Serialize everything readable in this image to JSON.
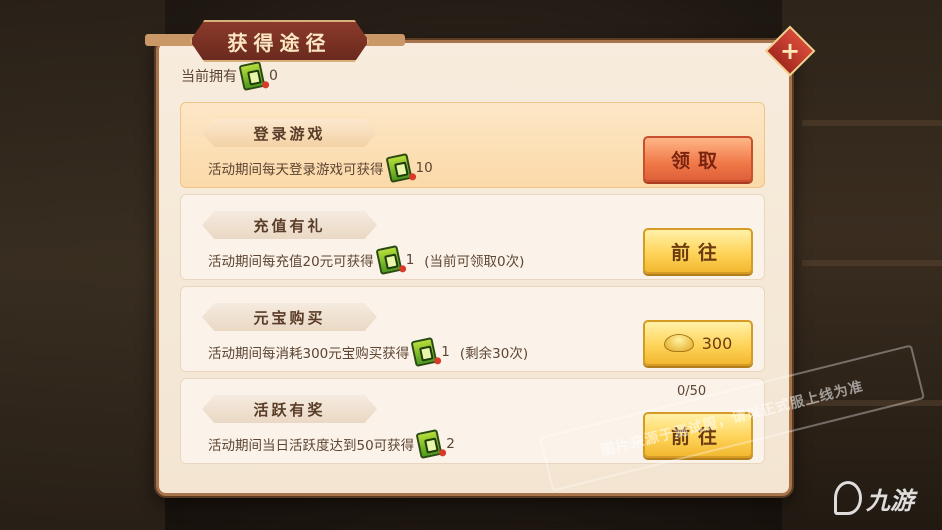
{
  "title": "获得途径",
  "owned": {
    "label": "当前拥有",
    "value": "0",
    "icon": "ticket-icon"
  },
  "close_label": "+",
  "rows": [
    {
      "tag": "登录游戏",
      "desc": "活动期间每天登录游戏可获得",
      "count": "10",
      "extra": "",
      "button": "领取",
      "button_style": "red"
    },
    {
      "tag": "充值有礼",
      "desc": "活动期间每充值20元可获得",
      "count": "1",
      "extra": "(当前可领取0次)",
      "button": "前往",
      "button_style": "yellow"
    },
    {
      "tag": "元宝购买",
      "desc": "活动期间每消耗300元宝购买获得",
      "count": "1",
      "extra": "(剩余30次)",
      "button": "300",
      "button_style": "yellow-ingot"
    },
    {
      "tag": "活跃有奖",
      "desc": "活动期间当日活跃度达到50可获得",
      "count": "2",
      "extra": "",
      "button": "前往",
      "button_style": "yellow",
      "progress": "0/50"
    }
  ],
  "watermark": "图片来源于测试服，请以正式服上线为准",
  "logo": "九游",
  "colors": {
    "panel": "#f7ecdd",
    "highlight": "#fbd9a8",
    "red_button": "#f07848",
    "yellow_button": "#ffd45a",
    "title_plate": "#8a3a2a"
  }
}
